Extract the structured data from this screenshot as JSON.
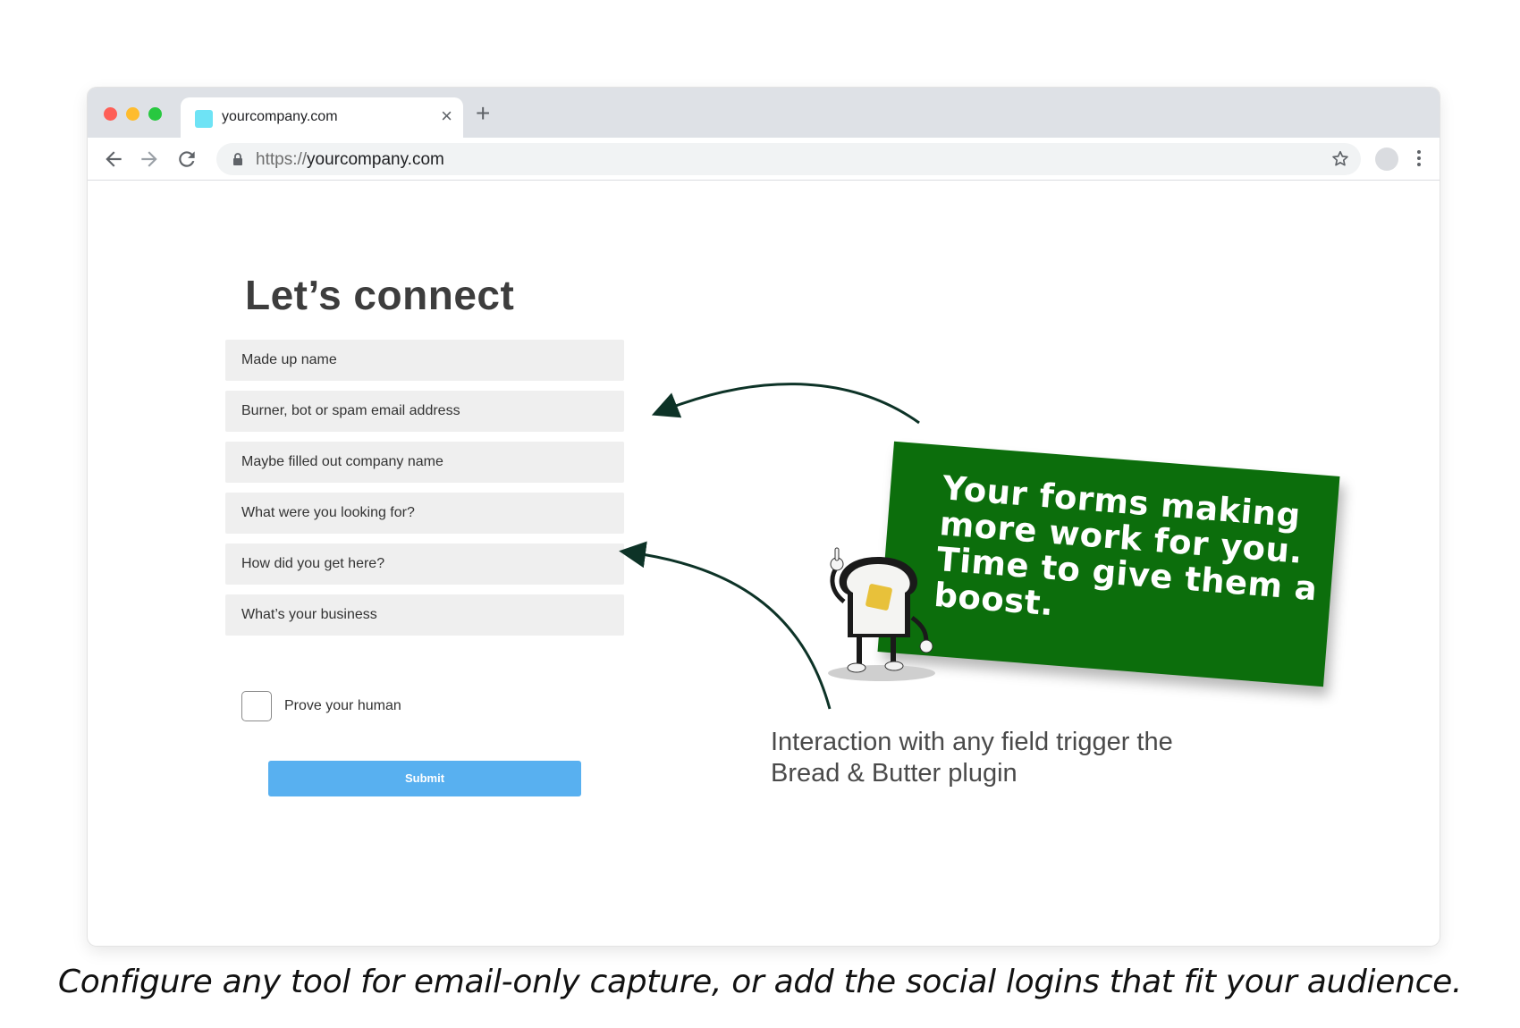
{
  "browser": {
    "tab": {
      "title": "yourcompany.com",
      "close": "×"
    },
    "new_tab": "+",
    "address": {
      "scheme": "https://",
      "host": "yourcompany.com"
    },
    "icons": [
      "back-icon",
      "forward-icon",
      "reload-icon",
      "lock-icon",
      "star-icon",
      "profile-icon",
      "menu-icon"
    ]
  },
  "form": {
    "title": "Let’s connect",
    "fields": [
      "Made up name",
      "Burner, bot or spam email address",
      "Maybe filled out company name",
      "What were you looking for?",
      "How did you get here?",
      "What’s your business"
    ],
    "checkbox_label": "Prove your human",
    "submit_label": "Submit"
  },
  "callout": {
    "card_text": "Your forms making more work for you. Time to give them a boost.",
    "note": "Interaction with any field trigger the Bread & Butter plugin"
  },
  "caption": "Configure any tool for email-only capture, or add the social logins that fit your audience.",
  "colors": {
    "card": "#0c6e0c",
    "submit": "#58b0f0",
    "arrow": "#0d3327",
    "favicon": "#6ee3f5"
  }
}
